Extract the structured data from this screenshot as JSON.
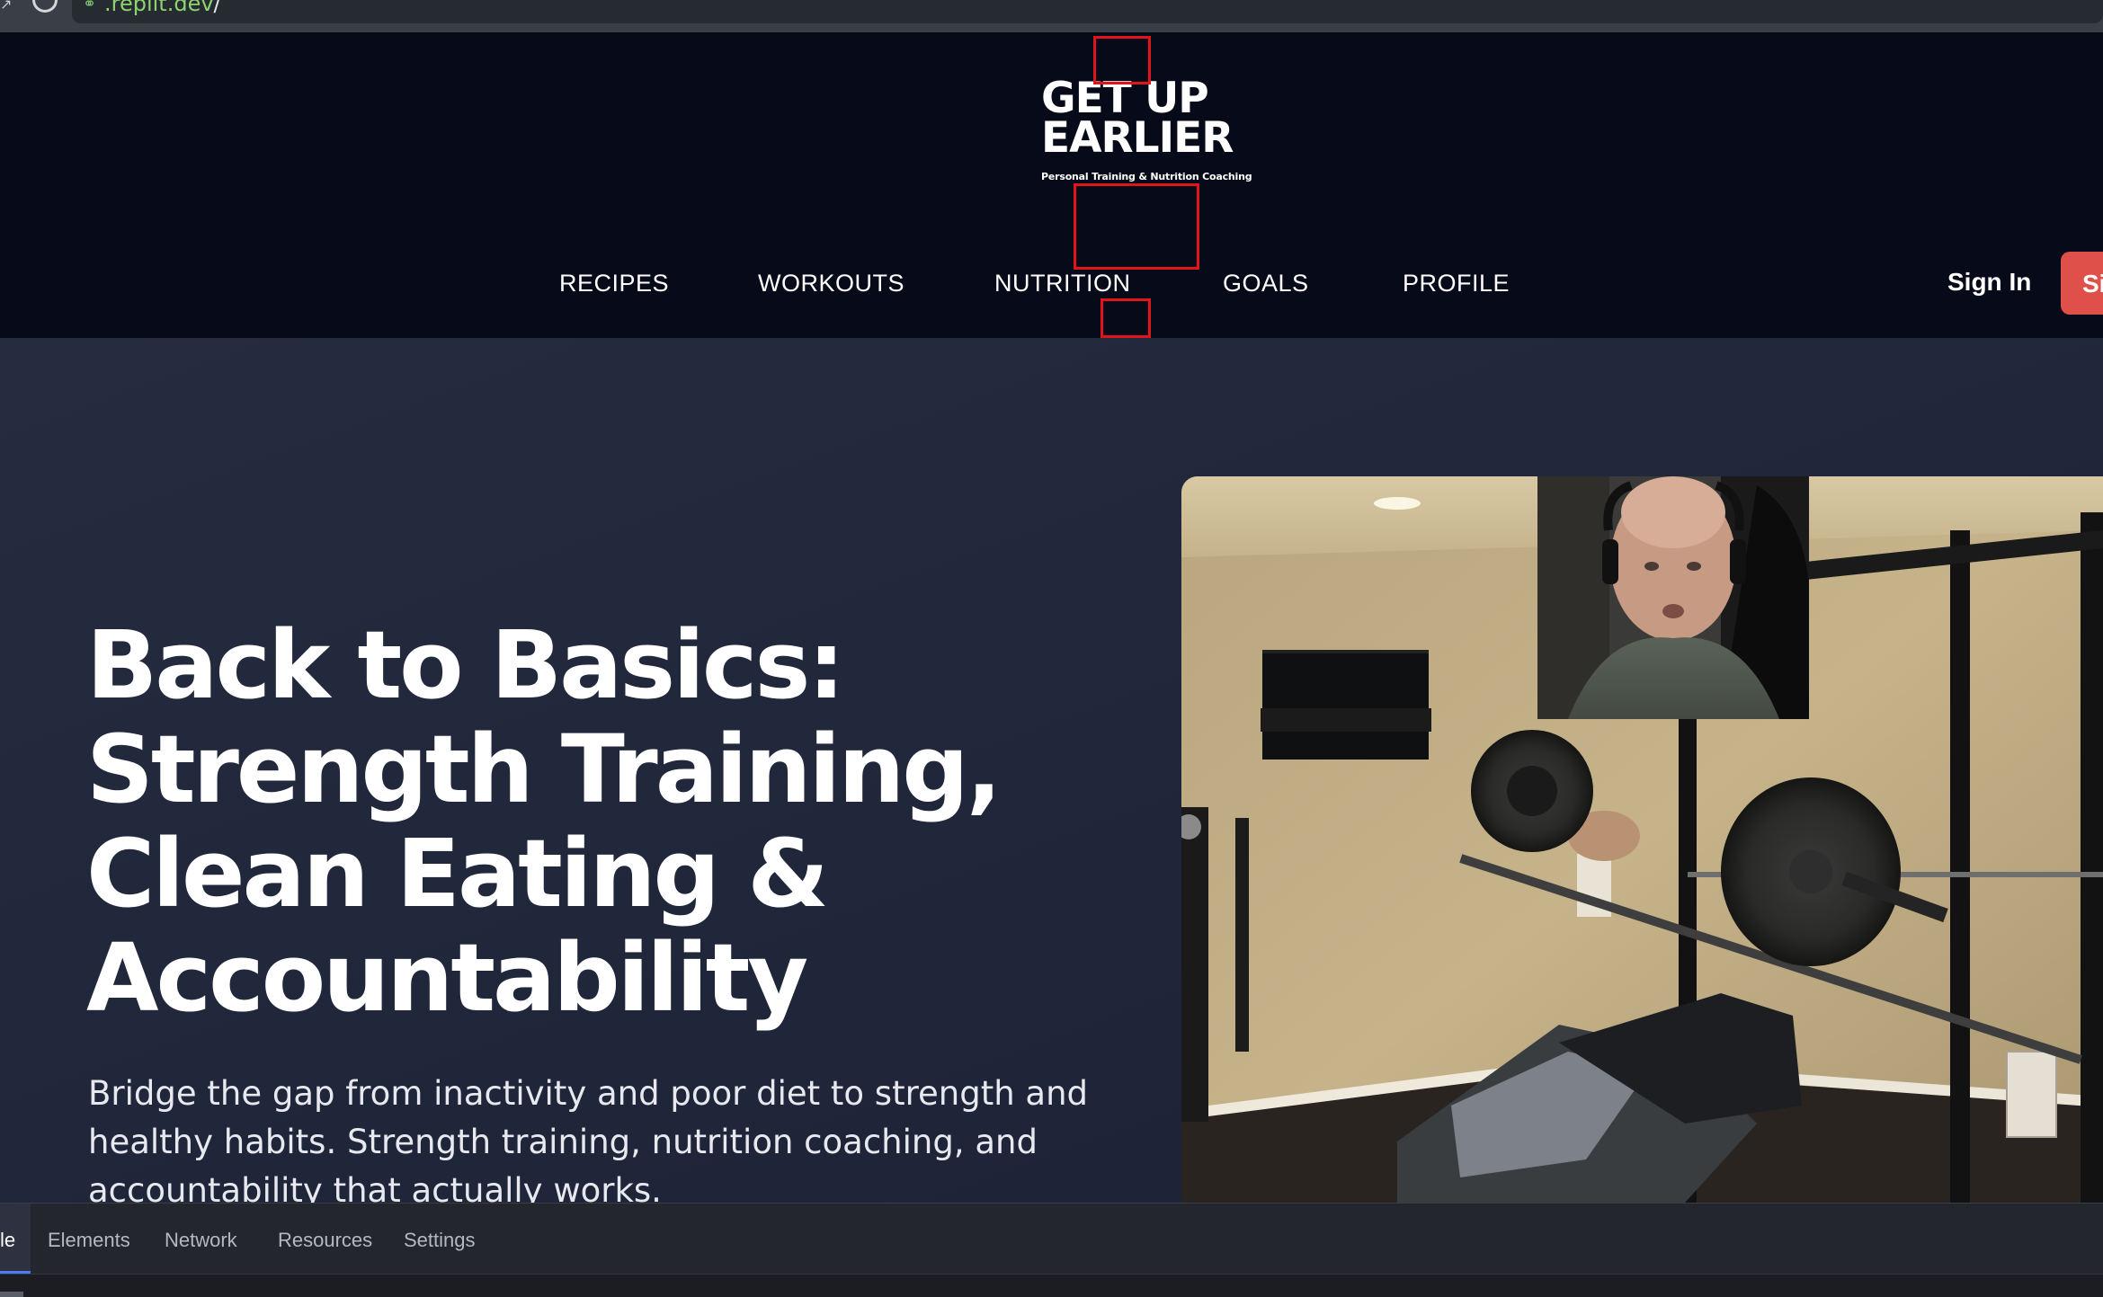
{
  "browser": {
    "url": ".replit.dev",
    "url_slash": "/"
  },
  "header": {
    "logo_line1": "GET UP",
    "logo_line2": "EARLIER",
    "logo_tagline": "Personal Training & Nutrition Coaching",
    "nav": [
      "RECIPES",
      "WORKOUTS",
      "NUTRITION",
      "GOALS",
      "PROFILE"
    ],
    "sign_in": "Sign In",
    "sign_up": "Si"
  },
  "hero": {
    "title_lines": [
      "Back to Basics:",
      "Strength Training,",
      "Clean Eating &",
      "Accountability"
    ],
    "text_lines": [
      "Bridge the gap from inactivity and poor diet to strength and",
      "healthy habits. Strength training, nutrition coaching, and",
      "accountability that actually works."
    ]
  },
  "devtools": {
    "active_tab": "le",
    "tabs": [
      "Elements",
      "Network",
      "Resources",
      "Settings"
    ]
  },
  "colors": {
    "header_bg": "#070a19",
    "hero_bg": "#242a3d",
    "accent": "#e0504a",
    "annotation": "#e0141a"
  }
}
